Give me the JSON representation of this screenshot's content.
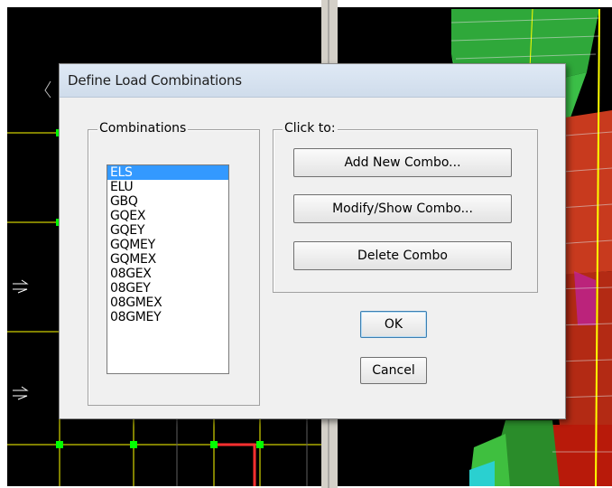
{
  "dialog": {
    "title": "Define Load Combinations",
    "combinations_group_label": "Combinations",
    "click_to_group_label": "Click to:",
    "combinations": [
      "ELS",
      "ELU",
      "GBQ",
      "GQEX",
      "GQEY",
      "GQMEY",
      "GQMEX",
      "08GEX",
      "08GEY",
      "08GMEX",
      "08GMEY"
    ],
    "selected_combination": "ELS",
    "buttons": {
      "add_new_combo": "Add New Combo...",
      "modify_show_combo": "Modify/Show Combo...",
      "delete_combo": "Delete Combo",
      "ok": "OK",
      "cancel": "Cancel"
    }
  },
  "colors": {
    "selection": "#3399ff",
    "dialog_background": "#f0f0f0",
    "viewport_background": "#000000",
    "grid_line": "#ffff00",
    "grid_node": "#00ff00"
  }
}
